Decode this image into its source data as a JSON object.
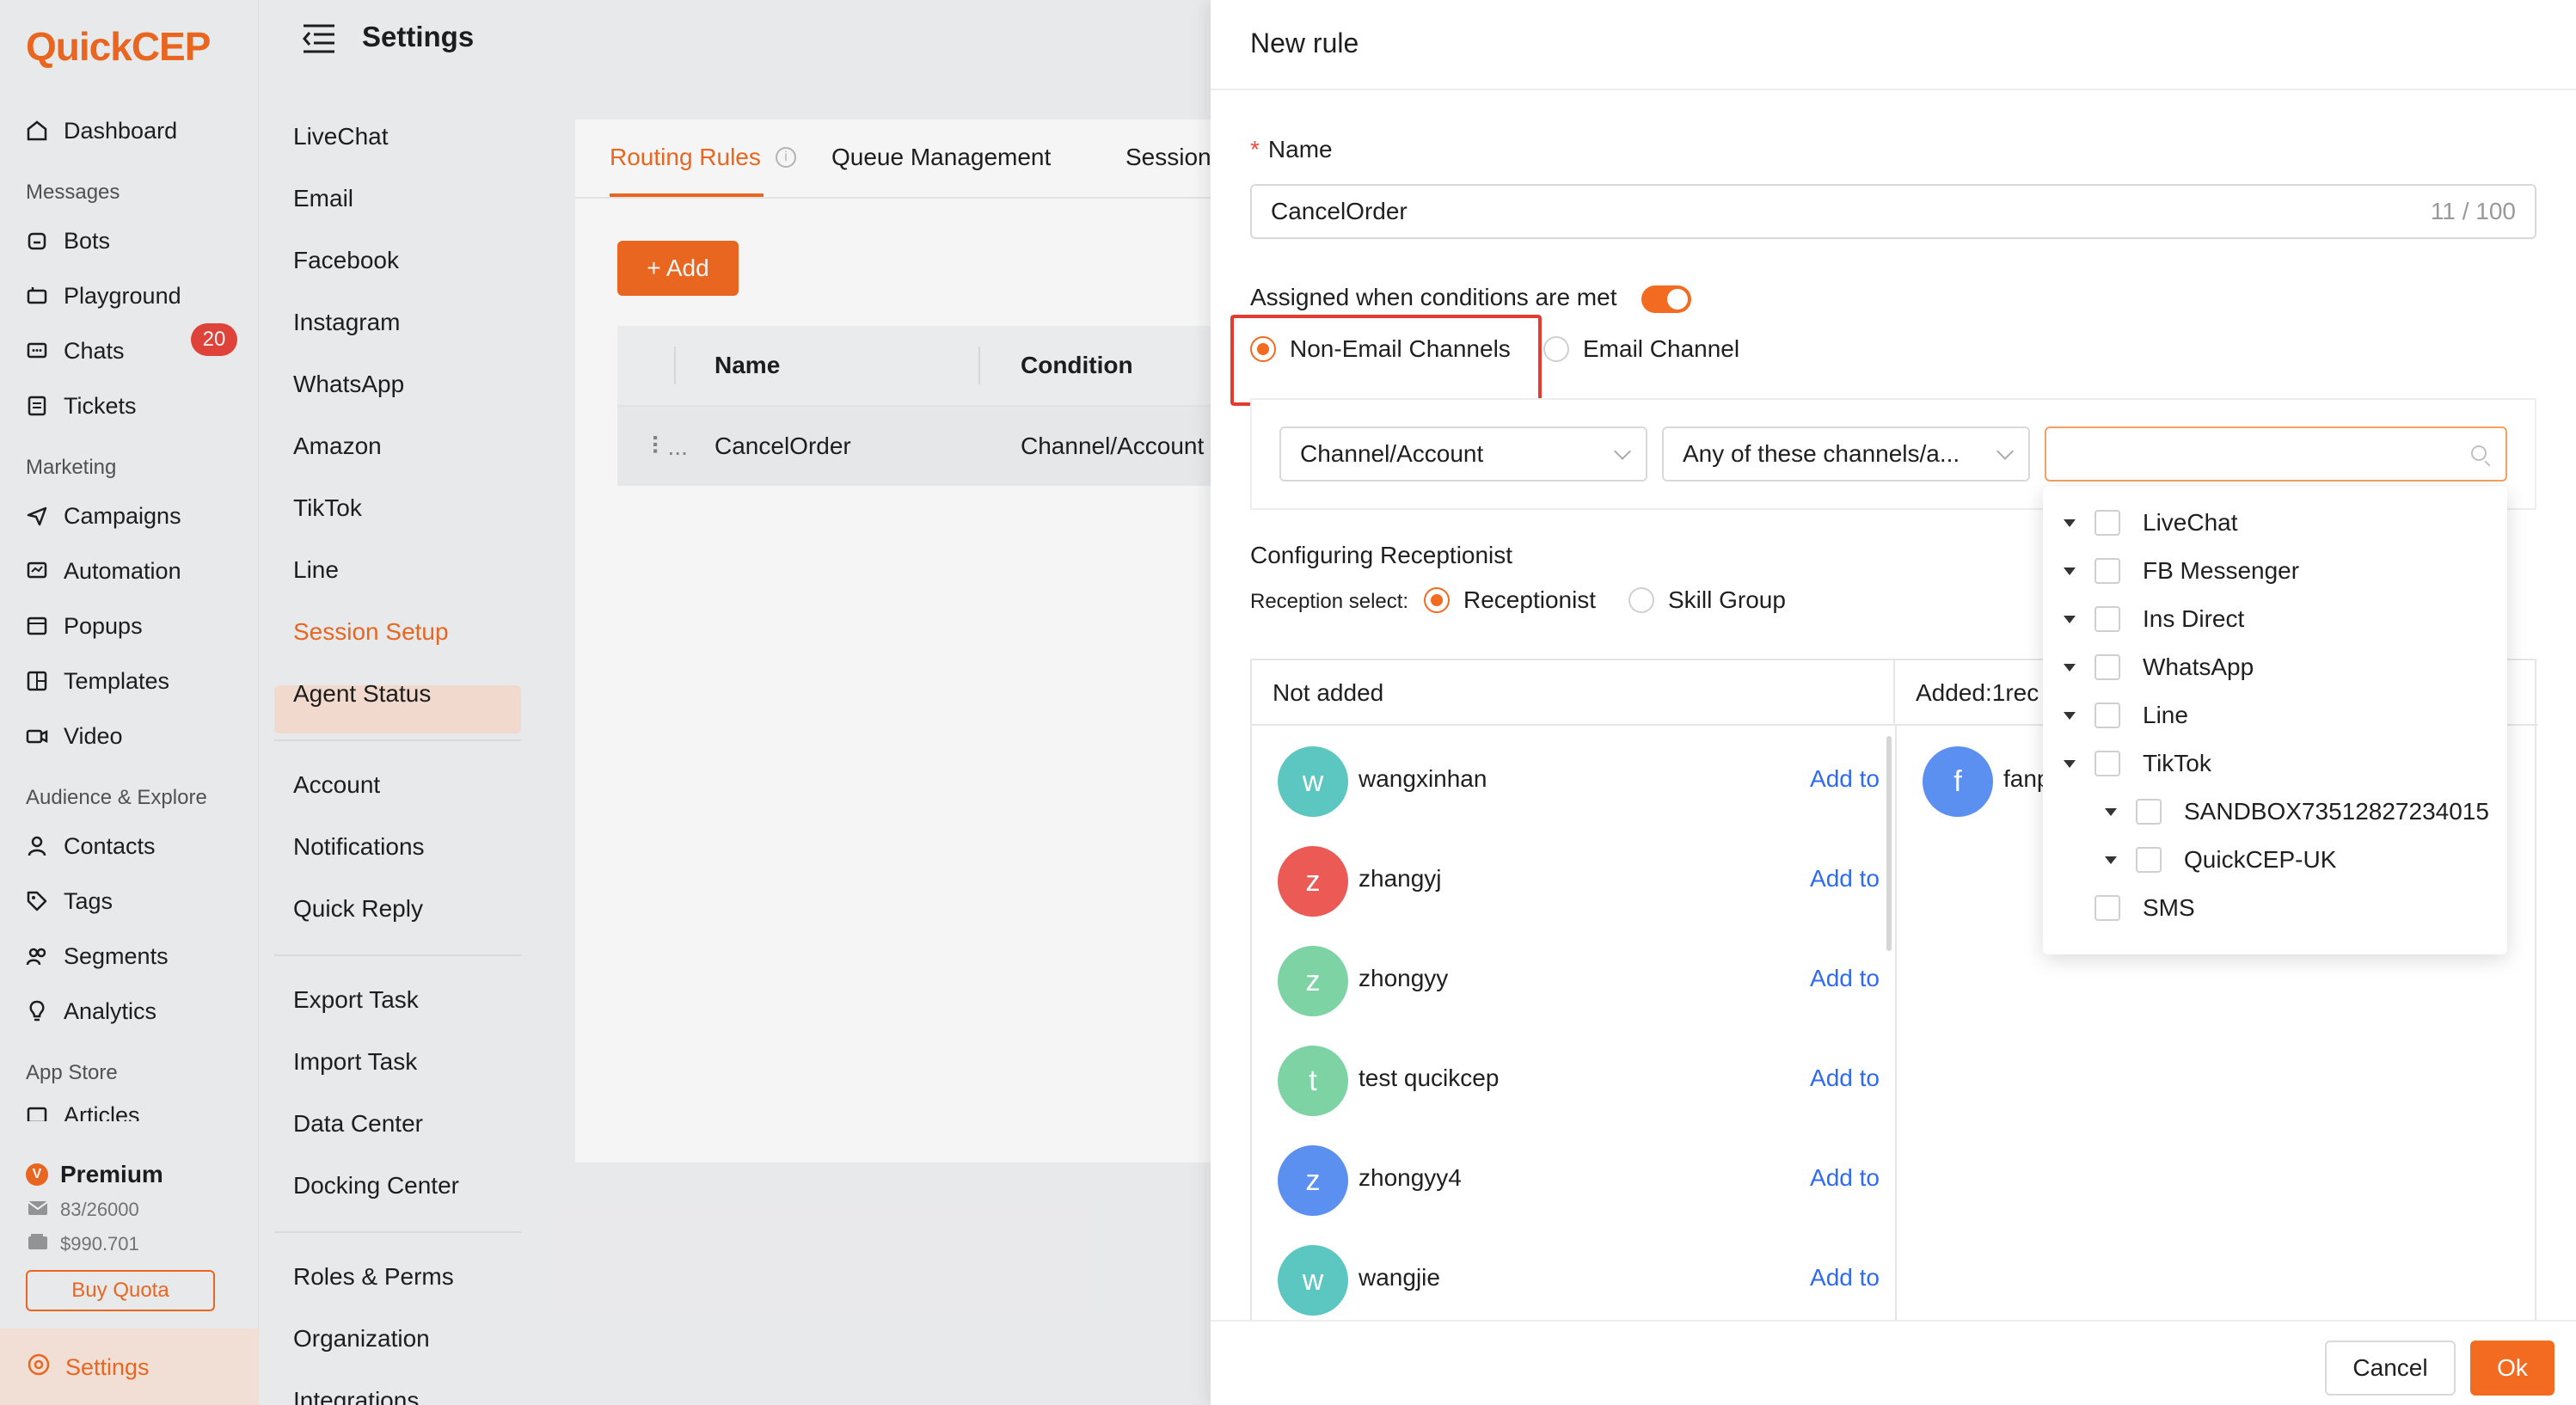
{
  "app": {
    "logo_q": "Q",
    "logo_rest": "uickCEP",
    "header_title": "Settings"
  },
  "nav": {
    "dashboard": "Dashboard",
    "group_messages": "Messages",
    "bots": "Bots",
    "playground": "Playground",
    "chats": "Chats",
    "chats_badge": "20",
    "tickets": "Tickets",
    "group_marketing": "Marketing",
    "campaigns": "Campaigns",
    "automation": "Automation",
    "popups": "Popups",
    "templates": "Templates",
    "video": "Video",
    "group_audience": "Audience & Explore",
    "contacts": "Contacts",
    "tags": "Tags",
    "segments": "Segments",
    "analytics": "Analytics",
    "group_appstore": "App Store",
    "articles": "Articles",
    "premium": "Premium",
    "premium_badge": "V",
    "quota_mail": "83/26000",
    "quota_money": "$990.701",
    "buy_quota": "Buy Quota",
    "settings": "Settings"
  },
  "submenu": {
    "livechat": "LiveChat",
    "email": "Email",
    "facebook": "Facebook",
    "instagram": "Instagram",
    "whatsapp": "WhatsApp",
    "amazon": "Amazon",
    "tiktok": "TikTok",
    "line": "Line",
    "session_setup": "Session Setup",
    "agent_status": "Agent Status",
    "account": "Account",
    "notifications": "Notifications",
    "quick_reply": "Quick Reply",
    "export_task": "Export Task",
    "import_task": "Import Task",
    "data_center": "Data Center",
    "docking_center": "Docking Center",
    "roles_perms": "Roles & Perms",
    "organization": "Organization",
    "integrations": "Integrations"
  },
  "content": {
    "tab_routing": "Routing Rules",
    "tab_queue": "Queue Management",
    "tab_session": "Session",
    "add_button": "+ Add",
    "col_name": "Name",
    "col_condition": "Condition",
    "row_drag": "⠇...",
    "row_name": "CancelOrder",
    "row_condition": "Channel/Account c"
  },
  "drawer": {
    "title": "New rule",
    "name_label": "Name",
    "name_required": "*",
    "name_value": "CancelOrder",
    "name_count": "11 / 100",
    "assigned_label": "Assigned when conditions are met",
    "assigned_toggle": true,
    "radio_non_email": "Non-Email Channels",
    "radio_email": "Email Channel",
    "cond_field": "Channel/Account",
    "cond_operator": "Any of these channels/a...",
    "cond_value_placeholder": "",
    "config_label": "Configuring Receptionist",
    "reception_select_label": "Reception select:",
    "radio_receptionist": "Receptionist",
    "radio_skill_group": "Skill Group",
    "not_added_header": "Not added",
    "added_header": "Added:1rec",
    "add_to": "Add to",
    "users": [
      {
        "initial": "w",
        "name": "wangxinhan",
        "color": "#5cc6c0"
      },
      {
        "initial": "z",
        "name": "zhangyj",
        "color": "#ec5a55"
      },
      {
        "initial": "z",
        "name": "zhongyy",
        "color": "#7dd3a4"
      },
      {
        "initial": "t",
        "name": "test qucikcep",
        "color": "#7dd3a4"
      },
      {
        "initial": "z",
        "name": "zhongyy4",
        "color": "#5b8ff0"
      },
      {
        "initial": "w",
        "name": "wangjie",
        "color": "#5cc6c0"
      }
    ],
    "added_user": {
      "initial": "f",
      "name": "fanp",
      "color": "#5b8ff0"
    },
    "cancel": "Cancel",
    "ok": "Ok"
  },
  "tree": {
    "items": [
      {
        "label": "LiveChat",
        "caret": true,
        "indent": 0
      },
      {
        "label": "FB Messenger",
        "caret": true,
        "indent": 0
      },
      {
        "label": "Ins Direct",
        "caret": true,
        "indent": 0
      },
      {
        "label": "WhatsApp",
        "caret": true,
        "indent": 0
      },
      {
        "label": "Line",
        "caret": true,
        "indent": 0
      },
      {
        "label": "TikTok",
        "caret": true,
        "indent": 0
      },
      {
        "label": "SANDBOX73512827234015",
        "caret": true,
        "indent": 1
      },
      {
        "label": "QuickCEP-UK",
        "caret": true,
        "indent": 1
      },
      {
        "label": "SMS",
        "caret": false,
        "indent": 0
      }
    ]
  },
  "colors": {
    "accent": "#f26b21",
    "link": "#2f6bf2",
    "highlight_box": "#e53b2f"
  }
}
